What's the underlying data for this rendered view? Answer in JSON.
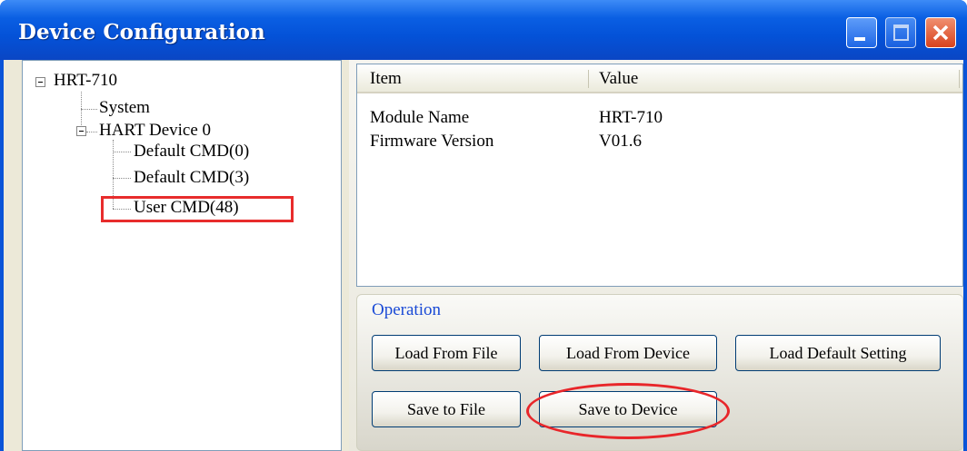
{
  "window": {
    "title": "Device Configuration"
  },
  "tree": {
    "root": "HRT-710",
    "system": "System",
    "device": "HART Device 0",
    "cmds": [
      "Default CMD(0)",
      "Default CMD(3)",
      "User CMD(48)"
    ]
  },
  "listview": {
    "columns": [
      "Item",
      "Value"
    ],
    "rows": [
      {
        "item": "Module Name",
        "value": "HRT-710"
      },
      {
        "item": "Firmware Version",
        "value": "V01.6"
      }
    ]
  },
  "operation": {
    "label": "Operation",
    "buttons": {
      "load_file": "Load From File",
      "load_device": "Load From Device",
      "load_default": "Load Default Setting",
      "save_file": "Save to File",
      "save_device": "Save to Device"
    }
  },
  "colors": {
    "titlebar": "#0452d8",
    "annotation": "#e82c2c",
    "group_label": "#1a4ad6"
  },
  "icons": [
    "minimize-icon",
    "maximize-icon",
    "close-icon"
  ]
}
